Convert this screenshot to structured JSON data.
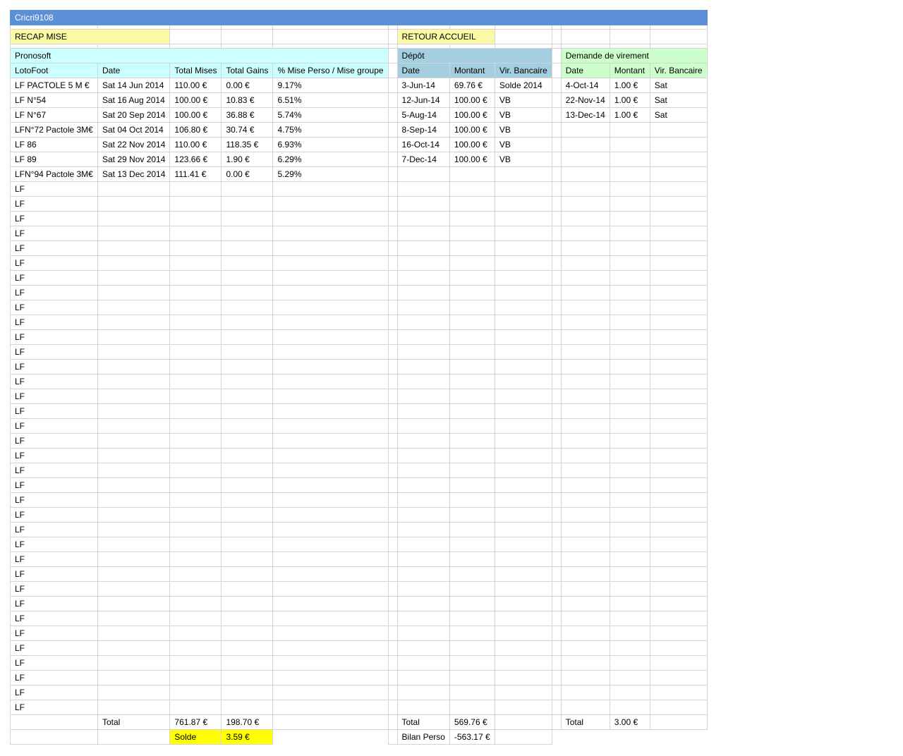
{
  "sheet_title": "Cricri9108",
  "nav": {
    "recap": "RECAP MISE",
    "home": "RETOUR ACCUEIL"
  },
  "pronosoft": {
    "title": "Pronosoft",
    "headers": [
      "LotoFoot",
      "Date",
      "Total Mises",
      "Total Gains",
      "% Mise Perso / Mise groupe"
    ],
    "rows": [
      [
        "LF PACTOLE 5 M €",
        "Sat 14 Jun 2014",
        "110.00 €",
        "0.00 €",
        "9.17%"
      ],
      [
        "LF N°54",
        "Sat 16 Aug 2014",
        "100.00 €",
        "10.83 €",
        "6.51%"
      ],
      [
        "LF N°67",
        "Sat 20 Sep 2014",
        "100.00 €",
        "36.88 €",
        "5.74%"
      ],
      [
        "LFN°72 Pactole 3M€",
        "Sat 04 Oct 2014",
        "106.80 €",
        "30.74 €",
        "4.75%"
      ],
      [
        "LF 86",
        "Sat 22 Nov 2014",
        "110.00 €",
        "118.35 €",
        "6.93%"
      ],
      [
        "LF 89",
        "Sat 29 Nov 2014",
        "123.66 €",
        "1.90 €",
        "6.29%"
      ],
      [
        "LFN°94 Pactole 3M€",
        "Sat 13 Dec 2014",
        "111.41 €",
        "0.00 €",
        "5.29%"
      ]
    ],
    "empty_label": "LF",
    "total_label": "Total",
    "total_mises": "761.87 €",
    "total_gains": "198.70 €",
    "solde_label": "Solde",
    "solde_value": "3.59 €"
  },
  "depot": {
    "title": "Dépôt",
    "headers": [
      "Date",
      "Montant",
      "Vir. Bancaire"
    ],
    "rows": [
      [
        "3-Jun-14",
        "69.76 €",
        "Solde 2014"
      ],
      [
        "12-Jun-14",
        "100.00 €",
        "VB"
      ],
      [
        "5-Aug-14",
        "100.00 €",
        "VB"
      ],
      [
        "8-Sep-14",
        "100.00 €",
        "VB"
      ],
      [
        "16-Oct-14",
        "100.00 €",
        "VB"
      ],
      [
        "7-Dec-14",
        "100.00 €",
        "VB"
      ]
    ],
    "total_label": "Total",
    "total_value": "569.76 €",
    "bilan_label": "Bilan Perso",
    "bilan_value": "-563.17 €"
  },
  "virement": {
    "title": "Demande de virement",
    "headers": [
      "Date",
      "Montant",
      "Vir. Bancaire"
    ],
    "rows": [
      [
        "4-Oct-14",
        "1.00 €",
        "Sat"
      ],
      [
        "22-Nov-14",
        "1.00 €",
        "Sat"
      ],
      [
        "13-Dec-14",
        "1.00 €",
        "Sat"
      ]
    ],
    "total_label": "Total",
    "total_value": "3.00 €"
  },
  "colors": {
    "title_bar": "#5b8fd6",
    "nav_yellow": "#fbf9a6",
    "pronosoft_header": "#ccffff",
    "depot_header": "#a3cfe0",
    "virement_header": "#ccffcc",
    "solde_highlight": "#ffff00"
  }
}
